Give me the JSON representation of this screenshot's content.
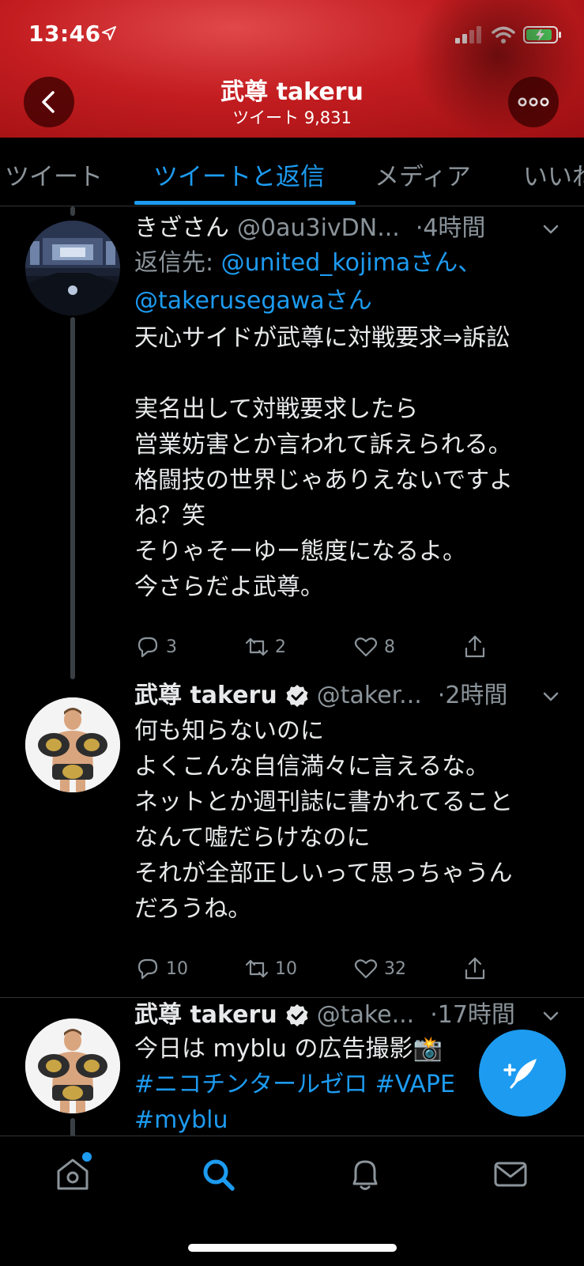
{
  "status_bar": {
    "time": "13:46"
  },
  "header": {
    "title": "武尊 takeru",
    "subtitle": "ツイート 9,831"
  },
  "tabs": [
    {
      "label": "ツイート"
    },
    {
      "label": "ツイートと返信",
      "active": true
    },
    {
      "label": "メディア"
    },
    {
      "label": "いいね"
    }
  ],
  "tweets": [
    {
      "name": "きざさん",
      "handle": "@0au3ivDN...",
      "time": "·4時間",
      "reply_prefix": "返信先: ",
      "reply_mentions_1": "@united_kojimaさん、",
      "reply_mentions_2": "@takerusegawaさん",
      "lines": [
        "天心サイドが武尊に対戦要求⇒訴訟",
        "",
        "実名出して対戦要求したら",
        "営業妨害とか言われて訴えられる。",
        "格闘技の世界じゃありえないですよ",
        "ね？笑",
        "そりゃそーゆー態度になるよ。",
        "今さらだよ武尊。"
      ],
      "replies": "3",
      "retweets": "2",
      "likes": "8"
    },
    {
      "name": "武尊 takeru",
      "handle": "@taker...",
      "time": "·2時間",
      "lines": [
        "何も知らないのに",
        "よくこんな自信満々に言えるな。",
        "ネットとか週刊誌に書かれてること",
        "なんて嘘だらけなのに",
        "それが全部正しいって思っちゃうん",
        "だろうね。"
      ],
      "replies": "10",
      "retweets": "10",
      "likes": "32"
    },
    {
      "name": "武尊 takeru",
      "handle": "@take...",
      "time": "·17時間",
      "line1": "今日は myblu の広告撮影📸",
      "hashtags": "#ニコチンタールゼロ #VAPE",
      "hashtag_partial": "#myblu"
    }
  ],
  "colors": {
    "accent": "#1d9bf0",
    "header_red": "#c31d20",
    "background": "#000000",
    "muted": "#8b949a"
  },
  "icons": [
    "back-icon",
    "more-icon",
    "chevron-down-icon",
    "verified-icon",
    "reply-icon",
    "retweet-icon",
    "like-icon",
    "share-icon",
    "compose-icon",
    "home-icon",
    "search-icon",
    "notifications-icon",
    "messages-icon"
  ]
}
